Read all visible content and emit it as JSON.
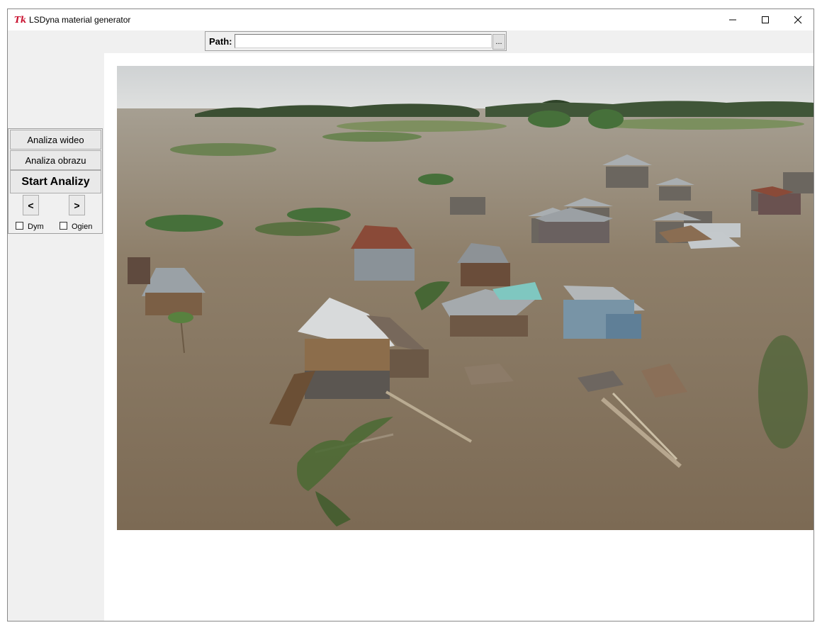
{
  "window": {
    "title": "LSDyna material generator",
    "icon": "tk-feather-icon"
  },
  "toolbar": {
    "path_label": "Path:",
    "path_value": "",
    "browse_label": "..."
  },
  "sidebar": {
    "analyze_video_label": "Analiza wideo",
    "analyze_image_label": "Analiza obrazu",
    "start_label": "Start Analizy",
    "prev_label": "<",
    "next_label": ">",
    "smoke_label": "Dym",
    "fire_label": "Ogien",
    "smoke_checked": false,
    "fire_checked": false
  },
  "image": {
    "subject": "aerial-photo-flooded-village",
    "colors": {
      "water": "#8a7a64",
      "sky": "#d8dadb",
      "vegetation": "#3f6b34"
    }
  }
}
